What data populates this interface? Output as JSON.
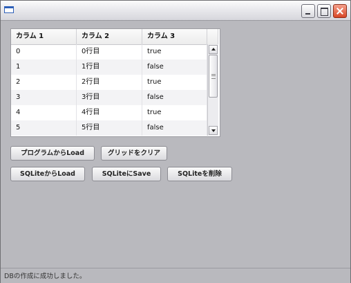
{
  "window": {
    "title": ""
  },
  "grid": {
    "columns": [
      "カラム 1",
      "カラム 2",
      "カラム 3"
    ],
    "rows": [
      [
        "0",
        "0行目",
        "true"
      ],
      [
        "1",
        "1行目",
        "false"
      ],
      [
        "2",
        "2行目",
        "true"
      ],
      [
        "3",
        "3行目",
        "false"
      ],
      [
        "4",
        "4行目",
        "true"
      ],
      [
        "5",
        "5行目",
        "false"
      ]
    ]
  },
  "buttons": {
    "load_program": "プログラムからLoad",
    "clear_grid": "グリッドをクリア",
    "load_sqlite": "SQLiteからLoad",
    "save_sqlite": "SQLiteにSave",
    "delete_sqlite": "SQLiteを削除"
  },
  "status": {
    "text": "DBの作成に成功しました。"
  },
  "icons": [
    "app-icon",
    "minimize-icon",
    "maximize-icon",
    "close-icon",
    "scroll-up-icon",
    "scroll-down-icon",
    "scroll-thumb-grip-icon"
  ]
}
